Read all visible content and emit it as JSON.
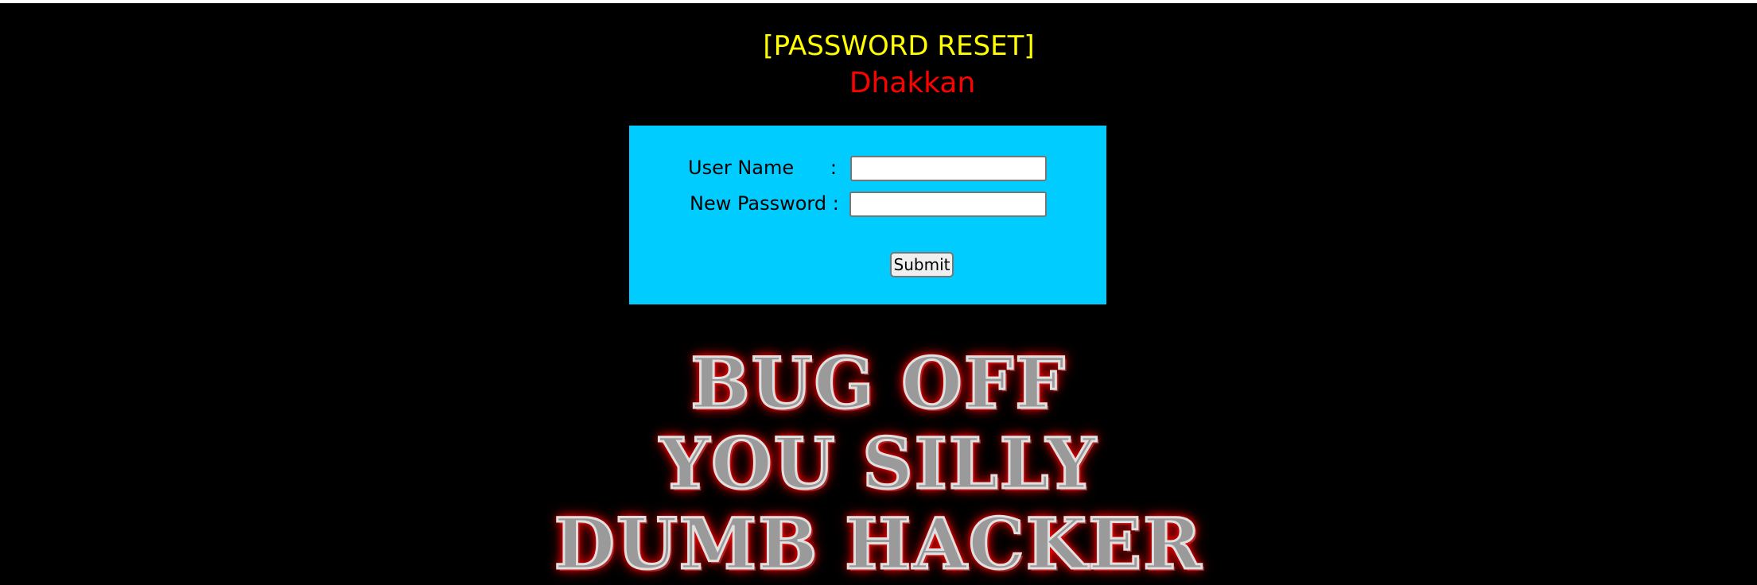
{
  "header": {
    "title": "[PASSWORD RESET]",
    "subtitle": "Dhakkan"
  },
  "form": {
    "username_label": "User Name      :",
    "username_value": "",
    "new_password_label": "New Password :",
    "new_password_value": "",
    "submit_label": "Submit"
  },
  "banner": {
    "lines": [
      "BUG OFF",
      "YOU SILLY",
      "DUMB HACKER"
    ]
  },
  "colors": {
    "background": "#000000",
    "title": "#ffff00",
    "subtitle": "#ff0000",
    "panel": "#00ccff",
    "banner_glow": "#ff0000"
  }
}
